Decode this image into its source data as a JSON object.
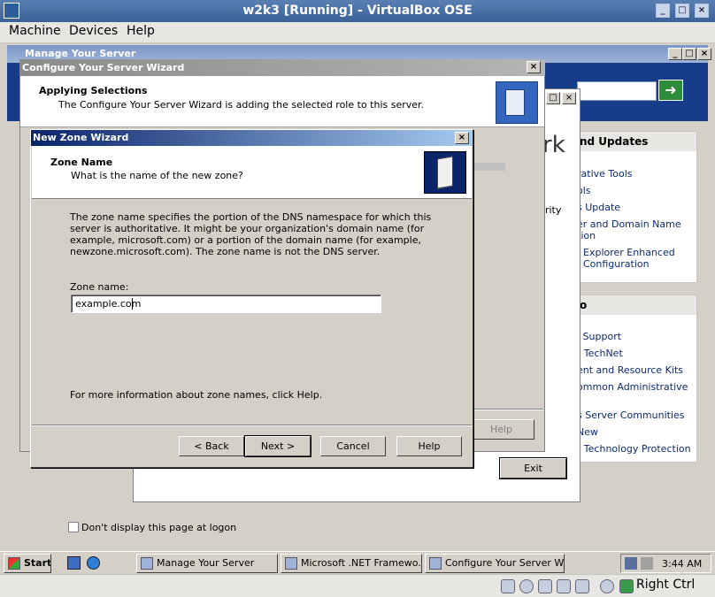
{
  "host": {
    "title": "w2k3 [Running] - VirtualBox OSE",
    "menu": [
      "Machine",
      "Devices",
      "Help"
    ],
    "host_key_label": "Right Ctrl"
  },
  "manage_server": {
    "title": "Manage Your Server",
    "search_go_icon": "arrow-right-icon",
    "panel1_heading": "nd Updates",
    "panel1_links": [
      "rative Tools",
      "ols",
      "s Update",
      "er and Domain Name",
      "tion",
      "Explorer Enhanced",
      "Configuration"
    ],
    "panel2_heading": "o",
    "panel2_links": [
      "l Support",
      "t TechNet",
      "ent and Resource Kits",
      "ommon Administrative",
      "s Server Communities",
      "New",
      "t Technology Protection"
    ],
    "fragment_rk": "rk",
    "fragment_urity": "urity",
    "exit_label": "Exit",
    "dont_display_label": "Don't display this page at logon"
  },
  "configure_wizard": {
    "title": "Configure Your Server Wizard",
    "heading": "Applying Selections",
    "subheading": "The Configure Your Server Wizard is adding the selected role to this server.",
    "help_label": "Help"
  },
  "new_zone_wizard": {
    "title": "New Zone Wizard",
    "heading": "Zone Name",
    "subheading": "What is the name of the new zone?",
    "description": "The zone name specifies the portion of the DNS namespace for which this server is authoritative. It might be your organization's domain name (for example,  microsoft.com) or a portion of the domain name (for example, newzone.microsoft.com). The zone name is not the DNS server.",
    "zone_name_label": "Zone name:",
    "zone_name_value": "example.com",
    "more_info": "For more information about zone names, click Help.",
    "buttons": {
      "back": "< Back",
      "next": "Next >",
      "cancel": "Cancel",
      "help": "Help"
    }
  },
  "taskbar": {
    "start_label": "Start",
    "tasks": [
      "Manage Your Server",
      "Microsoft .NET Framewo...",
      "Configure Your Server W..."
    ],
    "clock": "3:44 AM"
  },
  "colors": {
    "title_active": "#0a246a",
    "banner": "#163c8a",
    "window_face": "#d4d0c8"
  }
}
